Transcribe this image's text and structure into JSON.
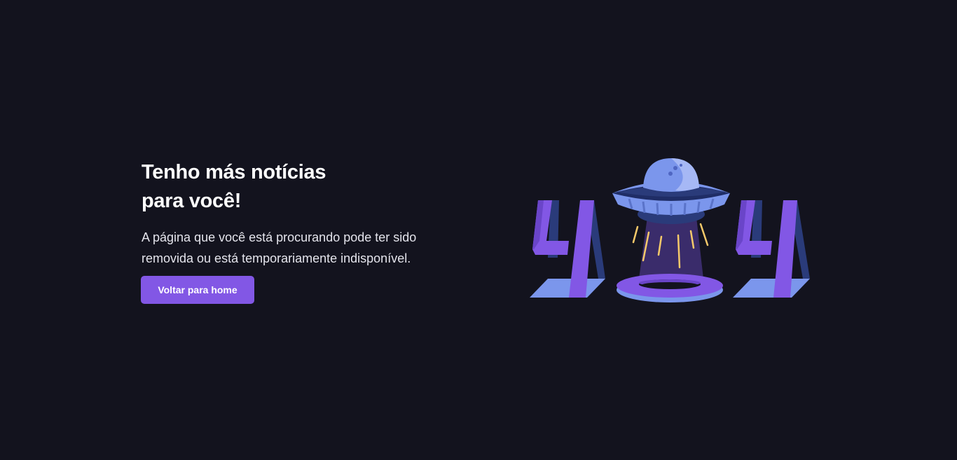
{
  "error_page": {
    "title_line_1": "Tenho más notícias",
    "title_line_2": "para você!",
    "description_line_1": "A página que você está procurando pode ter sido",
    "description_line_2": "removida ou está temporariamente indisponível.",
    "home_button_label": "Voltar para home"
  },
  "illustration": {
    "icon": "ufo-404-illustration",
    "colors": {
      "background": "#13131e",
      "purple": "#8257e5",
      "light_blue": "#7b96ec",
      "dark_blue": "#2a3b7a",
      "beam": "#3a2c6b",
      "sparks": "#f5c96a"
    }
  }
}
